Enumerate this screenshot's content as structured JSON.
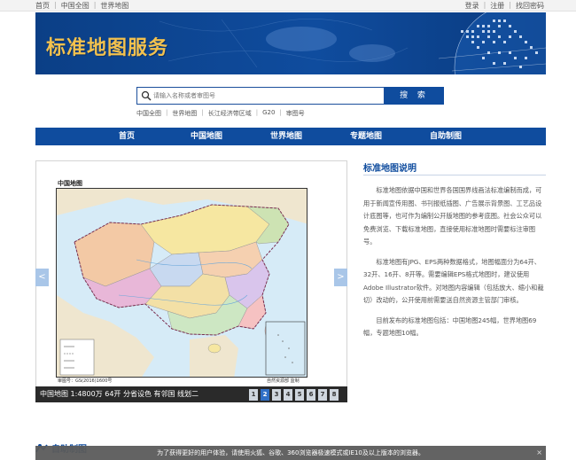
{
  "topbar": {
    "left_links": [
      "首页",
      "中国全图",
      "世界地图"
    ],
    "right_links": [
      "登录",
      "注册",
      "找回密码"
    ]
  },
  "banner": {
    "title": "标准地图服务"
  },
  "search": {
    "placeholder": "请输入名称或者审图号",
    "button_label": "搜 索",
    "quick_links": [
      "中国全图",
      "世界地图",
      "长江经济带区域",
      "G20",
      "审图号"
    ]
  },
  "nav": {
    "items": [
      "首页",
      "中国地图",
      "世界地图",
      "专题地图",
      "自助制图"
    ]
  },
  "carousel": {
    "map_title": "中国地图",
    "map_code": "审图号：GS(2016)1600号",
    "map_supervise": "自然资源部 监制",
    "caption": "中国地图 1:4800万 64开 分省设色 有邻国 线划二",
    "pages": [
      "1",
      "2",
      "3",
      "4",
      "5",
      "6",
      "7",
      "8"
    ],
    "active_page": "2",
    "prev_label": "<",
    "next_label": ">"
  },
  "explain": {
    "title": "标准地图说明",
    "paragraphs": [
      "标准地图依据中国和世界各国国界线画法标准编制而成，可用于新闻宣传用图、书刊报纸插图、广告展示背景图、工艺品设计底图等，也可作为编制公开版地图的参考底图。社会公众可以免费浏览、下载标准地图，直接使用标准地图时需要标注审图号。",
      "标准地图有JPG、EPS两种数据格式，地图幅面分为64开、32开、16开、8开等。需要编辑EPS格式地图时，建议使用Adobe Illustrator软件。对地图内容编辑（包括放大、缩小和裁切）改动的，公开使用前需要送自然资源主管部门审核。",
      "目前发布的标准地图包括：中国地图245幅，世界地图69幅，专题地图10幅。"
    ]
  },
  "section2": {
    "title": "自助制图"
  },
  "notice": {
    "text": "为了获得更好的用户体验，请使用火狐、谷歌、360浏览器极速模式或IE10及以上版本的浏览器。",
    "close": "×"
  },
  "colors": {
    "brand_blue": "#0f4c9e",
    "banner_gold": "#f2c14e",
    "active_page": "#2f6fc6"
  }
}
